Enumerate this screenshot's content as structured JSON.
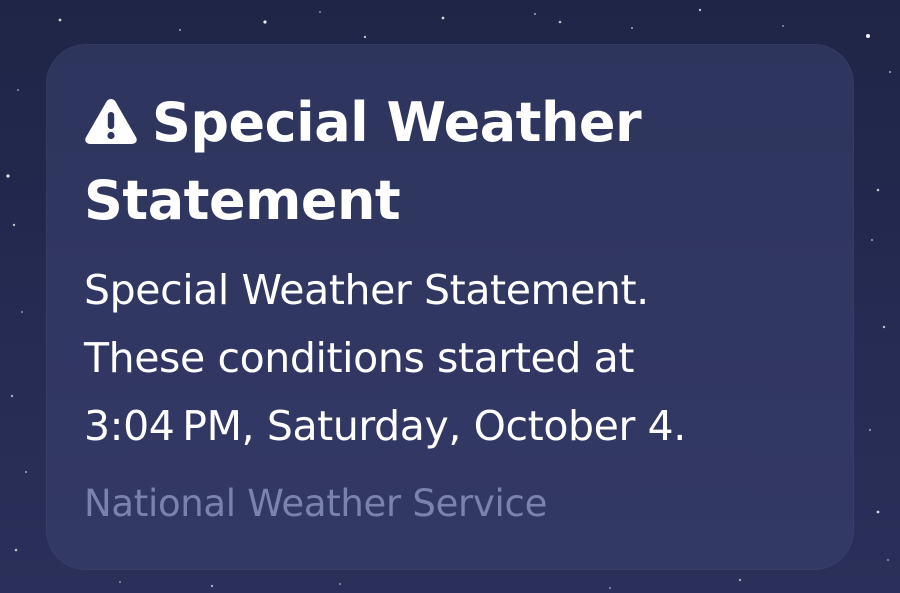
{
  "notification": {
    "icon": "warning-triangle-icon",
    "title_line1": "Special Weather",
    "title_line2": "Statement",
    "body_line1": "Special Weather Statement.",
    "body_line2": "These conditions started at",
    "body_line3": "3:04 PM, Saturday, October 4.",
    "source": "National Weather Service"
  },
  "colors": {
    "background": "#232950",
    "card": "#353c69",
    "title": "#ffffff",
    "body": "#ffffff",
    "source": "#7a83ad"
  }
}
